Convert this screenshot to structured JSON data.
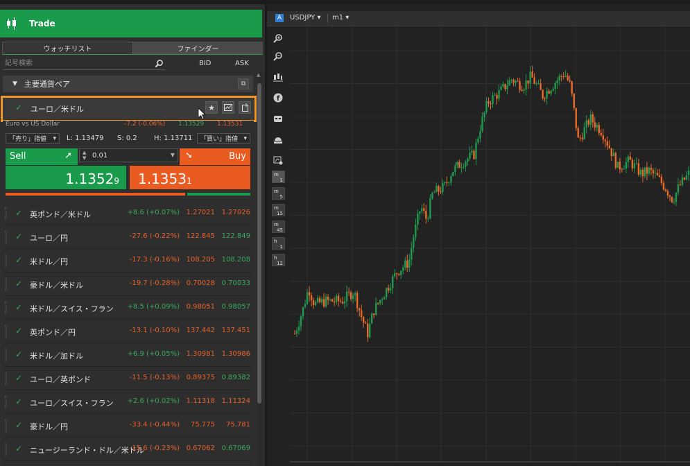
{
  "panel": {
    "title": "Trade",
    "tabs": [
      {
        "label": "ウォッチリスト",
        "active": true
      },
      {
        "label": "ファインダー",
        "active": false
      }
    ],
    "search_placeholder": "記号検索",
    "col_bid": "BID",
    "col_ask": "ASK"
  },
  "group": {
    "label": "主要通貨ペア"
  },
  "selected": {
    "name": "ユーロ／米ドル",
    "description": "Euro vs US Dollar",
    "change": "-7.2 (-0.06%)",
    "bid": "1.13529",
    "ask": "1.13531",
    "sell_order_type": "「売り」指値",
    "low": "L: 1.13479",
    "spread": "S: 0.2",
    "high": "H: 1.13711",
    "buy_order_type": "「買い」指値",
    "sell_label": "Sell",
    "buy_label": "Buy",
    "quantity": "0.01",
    "sell_price_main": "1.1352",
    "sell_price_small": "9",
    "buy_price_main": "1.1353",
    "buy_price_small": "1",
    "sentiment_sell_pct": 74,
    "sentiment_buy_pct": 26
  },
  "watchlist": [
    {
      "name": "英ポンド／米ドル",
      "change": "+8.6 (+0.07%)",
      "dir": "up",
      "bid": "1.27021",
      "ask": "1.27026",
      "ask_dir": "dn"
    },
    {
      "name": "ユーロ／円",
      "change": "-27.6 (-0.22%)",
      "dir": "dn",
      "bid": "122.845",
      "ask": "122.849",
      "ask_dir": "up"
    },
    {
      "name": "米ドル／円",
      "change": "-17.3 (-0.16%)",
      "dir": "dn",
      "bid": "108.205",
      "ask": "108.208",
      "ask_dir": "up"
    },
    {
      "name": "豪ドル／米ドル",
      "change": "-19.7 (-0.28%)",
      "dir": "dn",
      "bid": "0.70028",
      "ask": "0.70033",
      "ask_dir": "up"
    },
    {
      "name": "米ドル／スイス・フラン",
      "change": "+8.5 (+0.09%)",
      "dir": "up",
      "bid": "0.98051",
      "ask": "0.98057",
      "ask_dir": "up"
    },
    {
      "name": "英ポンド／円",
      "change": "-13.1 (-0.10%)",
      "dir": "dn",
      "bid": "137.442",
      "ask": "137.451",
      "ask_dir": "dn"
    },
    {
      "name": "米ドル／加ドル",
      "change": "+6.9 (+0.05%)",
      "dir": "up",
      "bid": "1.30981",
      "ask": "1.30986",
      "ask_dir": "dn"
    },
    {
      "name": "ユーロ／英ポンド",
      "change": "-11.5 (-0.13%)",
      "dir": "dn",
      "bid": "0.89375",
      "ask": "0.89382",
      "ask_dir": "up"
    },
    {
      "name": "ユーロ／スイス・フラン",
      "change": "+2.6 (+0.02%)",
      "dir": "up",
      "bid": "1.11318",
      "ask": "1.11324",
      "ask_dir": "dn"
    },
    {
      "name": "豪ドル／円",
      "change": "-33.4 (-0.44%)",
      "dir": "dn",
      "bid": "75.775",
      "ask": "75.781",
      "ask_dir": "dn"
    },
    {
      "name": "ニュージーランド・ドル／米ドル",
      "change": "-15.6 (-0.23%)",
      "dir": "dn",
      "bid": "0.67062",
      "ask": "0.67069",
      "ask_dir": "up"
    }
  ],
  "chart": {
    "symbol": "USDJPY",
    "timeframe": "m1",
    "source_icon": "A",
    "tools": [
      "zoom-in-icon",
      "zoom-out-icon",
      "candlestick-type-icon",
      "facebook-icon",
      "robot-icon",
      "drawing-tools-icon",
      "chart-settings-icon"
    ],
    "timeframes": [
      {
        "unit": "m",
        "n": "1",
        "active": true
      },
      {
        "unit": "m",
        "n": "5",
        "active": false
      },
      {
        "unit": "m",
        "n": "15",
        "active": false
      },
      {
        "unit": "m",
        "n": "45",
        "active": false
      },
      {
        "unit": "h",
        "n": "1",
        "active": false
      },
      {
        "unit": "h",
        "n": "12",
        "active": false
      }
    ],
    "colors": {
      "up": "#1f9a4e",
      "down": "#ea6a2a",
      "background": "#222222",
      "grid": "#2f2f2f"
    }
  },
  "chart_data": {
    "type": "candlestick",
    "symbol": "USDJPY",
    "timeframe": "m1",
    "grid": true,
    "close_path": [
      [
        0,
        0.17
      ],
      [
        0.02,
        0.24
      ],
      [
        0.035,
        0.31
      ],
      [
        0.05,
        0.26
      ],
      [
        0.08,
        0.27
      ],
      [
        0.12,
        0.27
      ],
      [
        0.15,
        0.3
      ],
      [
        0.17,
        0.22
      ],
      [
        0.185,
        0.17
      ],
      [
        0.2,
        0.24
      ],
      [
        0.23,
        0.3
      ],
      [
        0.26,
        0.36
      ],
      [
        0.29,
        0.39
      ],
      [
        0.3,
        0.46
      ],
      [
        0.32,
        0.56
      ],
      [
        0.335,
        0.52
      ],
      [
        0.35,
        0.6
      ],
      [
        0.38,
        0.62
      ],
      [
        0.4,
        0.67
      ],
      [
        0.43,
        0.7
      ],
      [
        0.455,
        0.72
      ],
      [
        0.47,
        0.8
      ],
      [
        0.49,
        0.88
      ],
      [
        0.52,
        0.91
      ],
      [
        0.55,
        0.95
      ],
      [
        0.58,
        0.93
      ],
      [
        0.6,
        0.96
      ],
      [
        0.63,
        0.9
      ],
      [
        0.66,
        0.94
      ],
      [
        0.685,
        0.97
      ],
      [
        0.7,
        0.93
      ],
      [
        0.72,
        0.76
      ],
      [
        0.75,
        0.83
      ],
      [
        0.78,
        0.79
      ],
      [
        0.8,
        0.74
      ],
      [
        0.82,
        0.68
      ],
      [
        0.85,
        0.7
      ],
      [
        0.88,
        0.66
      ],
      [
        0.9,
        0.67
      ],
      [
        0.92,
        0.65
      ],
      [
        0.94,
        0.62
      ],
      [
        0.96,
        0.58
      ],
      [
        0.975,
        0.62
      ],
      [
        1.0,
        0.66
      ]
    ]
  }
}
